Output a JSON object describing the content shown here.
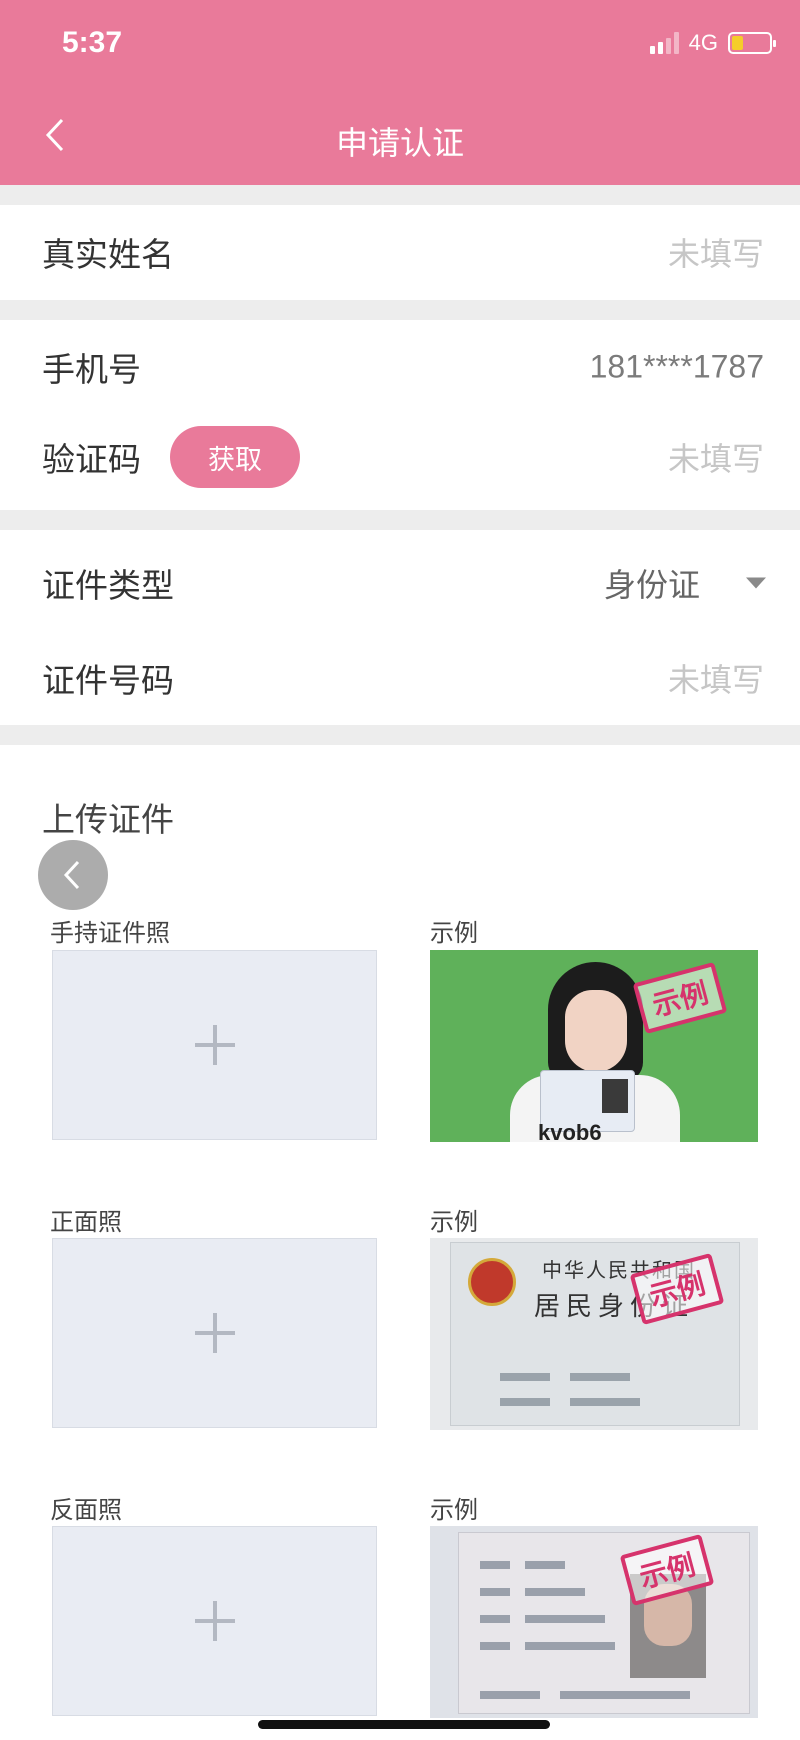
{
  "status_bar": {
    "time": "5:37",
    "network": "4G"
  },
  "header": {
    "title": "申请认证",
    "back_icon": "chevron-left-icon"
  },
  "form": {
    "name": {
      "label": "真实姓名",
      "value": "未填写"
    },
    "phone": {
      "label": "手机号",
      "value": "181****1787"
    },
    "code": {
      "label": "验证码",
      "button": "获取",
      "value": "未填写"
    },
    "id_type": {
      "label": "证件类型",
      "value": "身份证"
    },
    "id_number": {
      "label": "证件号码",
      "value": "未填写"
    }
  },
  "upload": {
    "title": "上传证件",
    "rows": [
      {
        "label": "手持证件照",
        "example_label": "示例",
        "stamp": "示例",
        "example_text": "kvob6"
      },
      {
        "label": "正面照",
        "example_label": "示例",
        "stamp": "示例",
        "card_line1": "中华人民共和国",
        "card_line2": "居民身份证"
      },
      {
        "label": "反面照",
        "example_label": "示例",
        "stamp": "示例"
      }
    ]
  },
  "colors": {
    "accent": "#e97a9a",
    "placeholder": "#c6c6c6"
  }
}
